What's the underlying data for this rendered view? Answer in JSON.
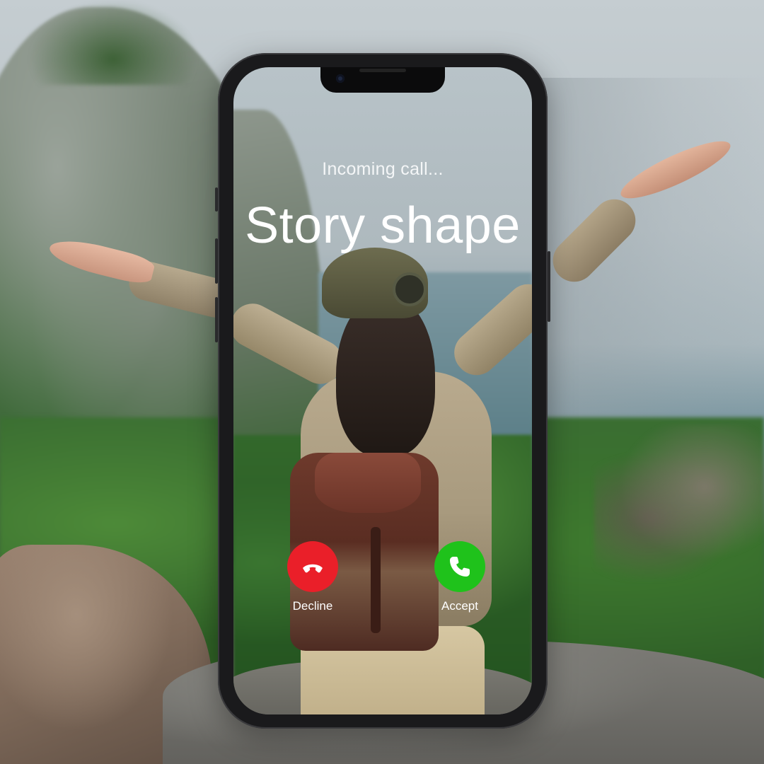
{
  "call": {
    "status": "Incoming call...",
    "caller_name": "Story shape"
  },
  "actions": {
    "decline": {
      "label": "Decline",
      "icon": "phone-hangup-icon",
      "color": "#ea1f29"
    },
    "accept": {
      "label": "Accept",
      "icon": "phone-icon",
      "color": "#1fc21b"
    }
  }
}
